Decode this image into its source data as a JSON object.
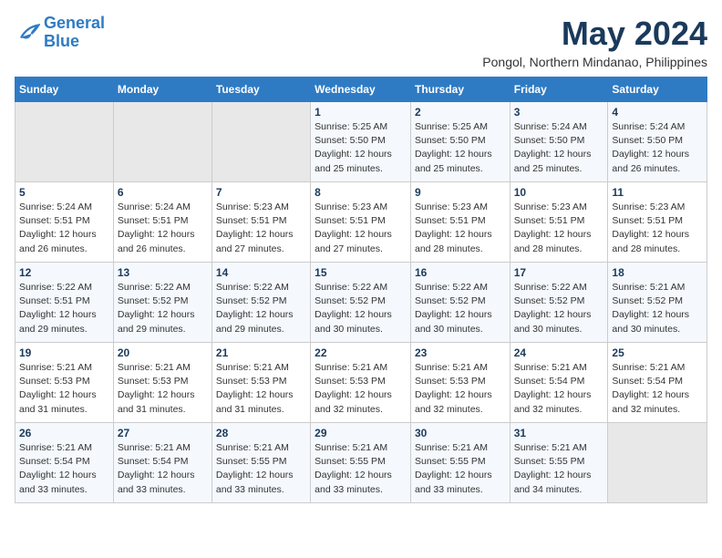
{
  "logo": {
    "line1": "General",
    "line2": "Blue"
  },
  "title": "May 2024",
  "location": "Pongol, Northern Mindanao, Philippines",
  "days_header": [
    "Sunday",
    "Monday",
    "Tuesday",
    "Wednesday",
    "Thursday",
    "Friday",
    "Saturday"
  ],
  "weeks": [
    [
      {
        "day": "",
        "info": ""
      },
      {
        "day": "",
        "info": ""
      },
      {
        "day": "",
        "info": ""
      },
      {
        "day": "1",
        "info": "Sunrise: 5:25 AM\nSunset: 5:50 PM\nDaylight: 12 hours\nand 25 minutes."
      },
      {
        "day": "2",
        "info": "Sunrise: 5:25 AM\nSunset: 5:50 PM\nDaylight: 12 hours\nand 25 minutes."
      },
      {
        "day": "3",
        "info": "Sunrise: 5:24 AM\nSunset: 5:50 PM\nDaylight: 12 hours\nand 25 minutes."
      },
      {
        "day": "4",
        "info": "Sunrise: 5:24 AM\nSunset: 5:50 PM\nDaylight: 12 hours\nand 26 minutes."
      }
    ],
    [
      {
        "day": "5",
        "info": "Sunrise: 5:24 AM\nSunset: 5:51 PM\nDaylight: 12 hours\nand 26 minutes."
      },
      {
        "day": "6",
        "info": "Sunrise: 5:24 AM\nSunset: 5:51 PM\nDaylight: 12 hours\nand 26 minutes."
      },
      {
        "day": "7",
        "info": "Sunrise: 5:23 AM\nSunset: 5:51 PM\nDaylight: 12 hours\nand 27 minutes."
      },
      {
        "day": "8",
        "info": "Sunrise: 5:23 AM\nSunset: 5:51 PM\nDaylight: 12 hours\nand 27 minutes."
      },
      {
        "day": "9",
        "info": "Sunrise: 5:23 AM\nSunset: 5:51 PM\nDaylight: 12 hours\nand 28 minutes."
      },
      {
        "day": "10",
        "info": "Sunrise: 5:23 AM\nSunset: 5:51 PM\nDaylight: 12 hours\nand 28 minutes."
      },
      {
        "day": "11",
        "info": "Sunrise: 5:23 AM\nSunset: 5:51 PM\nDaylight: 12 hours\nand 28 minutes."
      }
    ],
    [
      {
        "day": "12",
        "info": "Sunrise: 5:22 AM\nSunset: 5:51 PM\nDaylight: 12 hours\nand 29 minutes."
      },
      {
        "day": "13",
        "info": "Sunrise: 5:22 AM\nSunset: 5:52 PM\nDaylight: 12 hours\nand 29 minutes."
      },
      {
        "day": "14",
        "info": "Sunrise: 5:22 AM\nSunset: 5:52 PM\nDaylight: 12 hours\nand 29 minutes."
      },
      {
        "day": "15",
        "info": "Sunrise: 5:22 AM\nSunset: 5:52 PM\nDaylight: 12 hours\nand 30 minutes."
      },
      {
        "day": "16",
        "info": "Sunrise: 5:22 AM\nSunset: 5:52 PM\nDaylight: 12 hours\nand 30 minutes."
      },
      {
        "day": "17",
        "info": "Sunrise: 5:22 AM\nSunset: 5:52 PM\nDaylight: 12 hours\nand 30 minutes."
      },
      {
        "day": "18",
        "info": "Sunrise: 5:21 AM\nSunset: 5:52 PM\nDaylight: 12 hours\nand 30 minutes."
      }
    ],
    [
      {
        "day": "19",
        "info": "Sunrise: 5:21 AM\nSunset: 5:53 PM\nDaylight: 12 hours\nand 31 minutes."
      },
      {
        "day": "20",
        "info": "Sunrise: 5:21 AM\nSunset: 5:53 PM\nDaylight: 12 hours\nand 31 minutes."
      },
      {
        "day": "21",
        "info": "Sunrise: 5:21 AM\nSunset: 5:53 PM\nDaylight: 12 hours\nand 31 minutes."
      },
      {
        "day": "22",
        "info": "Sunrise: 5:21 AM\nSunset: 5:53 PM\nDaylight: 12 hours\nand 32 minutes."
      },
      {
        "day": "23",
        "info": "Sunrise: 5:21 AM\nSunset: 5:53 PM\nDaylight: 12 hours\nand 32 minutes."
      },
      {
        "day": "24",
        "info": "Sunrise: 5:21 AM\nSunset: 5:54 PM\nDaylight: 12 hours\nand 32 minutes."
      },
      {
        "day": "25",
        "info": "Sunrise: 5:21 AM\nSunset: 5:54 PM\nDaylight: 12 hours\nand 32 minutes."
      }
    ],
    [
      {
        "day": "26",
        "info": "Sunrise: 5:21 AM\nSunset: 5:54 PM\nDaylight: 12 hours\nand 33 minutes."
      },
      {
        "day": "27",
        "info": "Sunrise: 5:21 AM\nSunset: 5:54 PM\nDaylight: 12 hours\nand 33 minutes."
      },
      {
        "day": "28",
        "info": "Sunrise: 5:21 AM\nSunset: 5:55 PM\nDaylight: 12 hours\nand 33 minutes."
      },
      {
        "day": "29",
        "info": "Sunrise: 5:21 AM\nSunset: 5:55 PM\nDaylight: 12 hours\nand 33 minutes."
      },
      {
        "day": "30",
        "info": "Sunrise: 5:21 AM\nSunset: 5:55 PM\nDaylight: 12 hours\nand 33 minutes."
      },
      {
        "day": "31",
        "info": "Sunrise: 5:21 AM\nSunset: 5:55 PM\nDaylight: 12 hours\nand 34 minutes."
      },
      {
        "day": "",
        "info": ""
      }
    ]
  ]
}
